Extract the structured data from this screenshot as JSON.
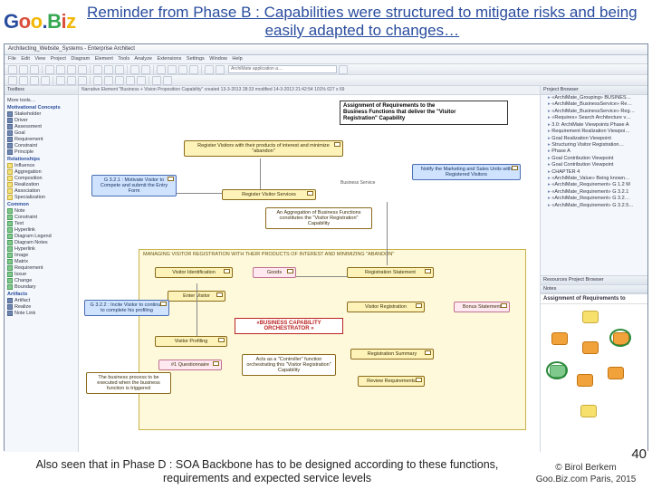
{
  "logo": {
    "text": "Goo.Biz"
  },
  "header": {
    "title": "Reminder from Phase B : Capabilities were structured to mitigate risks and being easily adapted to changes…"
  },
  "app": {
    "window_title": "Architecting_Website_Systems - Enterprise Architect",
    "menu": "File  Edit  View  Project  Diagram  Element  Tools  Analyze  Extensions  Settings  Window  Help",
    "search_placeholder": "ArchiMate application a…",
    "canvas_tab": "Narrative  Element  \"Business + Vision Proposition Capability\"  created  13-3-2013  28:33 modified  14-3-2013 21:42:54  101%  627 x  69"
  },
  "leftpane": {
    "tab": "Toolbox",
    "search": "More tools…",
    "sec1": "Motivational Concepts",
    "items1": [
      "Stakeholder",
      "Driver",
      "Assessment",
      "Goal",
      "Requirement",
      "Constraint",
      "Principle"
    ],
    "sec2": "Relationships",
    "items2": [
      "Influence",
      "Aggregation",
      "Composition",
      "Realization",
      "Association",
      "Specialization"
    ],
    "sec3": "Common",
    "items3": [
      "Note",
      "Constraint",
      "Text",
      "Hyperlink",
      "Diagram Legend",
      "Diagram Notes",
      "Hyperlink",
      "Image",
      "Matrix",
      "Requirement",
      "Issue",
      "Change",
      "Boundary"
    ],
    "sec4": "Artifacts",
    "items4": [
      "Artifact",
      "Realize",
      "Note Link"
    ]
  },
  "panel_main": {
    "line1": "Assignment of Requirements to  the",
    "line2": "Business Functions that deliver the \"Visitor",
    "line3": "Registration\" Capability"
  },
  "elems": {
    "e1": "Register Visitors with their products of interest and minimize \"abandon\"",
    "e2": "G 3.2.1 : Motivate Visitor to Compete and submit the Entry Form",
    "e3": "Register Visitor Services",
    "e4": "Business Service",
    "e5": "An Aggregation of Business Functions constitutes the \"Visitor Registration\" Capability",
    "e6": "Notify the Marketing and Sales Units with Registered Visitors",
    "big_caption": "MANAGING VISITOR REGISTRATION WITH THEIR PRODUCTS OF INTEREST AND MINIMIZING \"ABANDON\"",
    "e7": "Visitor Identification",
    "e8": "Goods",
    "e9": "Registration Statement",
    "e10": "Enter Visitor",
    "e11": "G 3.2.2 : Incite Visitor to continue to complete his profiling",
    "e12": "Visitor Profiling",
    "orch": "«BUSINESS CAPABILITY ORCHESTRATOR »",
    "e13": "#1 Questionnaire",
    "e14": "The business process to be executed when the business function is triggered",
    "e15": "Visitor Registration",
    "e16": "Acts as a \"Controller\" function orchestrating this \"Visitor Registration\" Capability",
    "e17": "Registration Summary",
    "e18": "Bonus Statement",
    "e19": "Review Requirements"
  },
  "rightpane": {
    "top_tab": "Project Browser",
    "tree": [
      "«ArchiMate_Grouping» BUSINES…",
      "«ArchiMate_BusinessService» Re…",
      "«ArchiMate_BusinessService» Reg…",
      "«Requires» Search Architecture v…",
      "3.0: ArchiMate Viewpoints Phase A",
      "Requirement Realization Viewpoi…",
      "Goal Realization Viewpoint",
      "Structuring Visitor Registration…",
      "Phase A",
      "Goal Contribution Viewpoint",
      "Goal Contribution Viewpoint",
      "CHAPTER 4",
      "«ArchiMate_Value» Being known…",
      "«ArchiMate_Requirement» G 1.2 M",
      "«ArchiMate_Requirement» G 3.2.1",
      "«ArchiMate_Requirement» G 3.2…",
      "«ArchiMate_Requirement» G 3.2.5…"
    ],
    "mid_tab": "Resources   Project Browser",
    "notes_tab": "Notes",
    "bot_title": "Assignment of Requirements to"
  },
  "footer": {
    "text": "Also seen that in Phase D : SOA Backbone has to be  designed according to these functions, requirements  and expected service levels",
    "credit1": "© Birol Berkem",
    "credit2": "Goo.Biz.com  Paris, 2015",
    "page": "40"
  }
}
